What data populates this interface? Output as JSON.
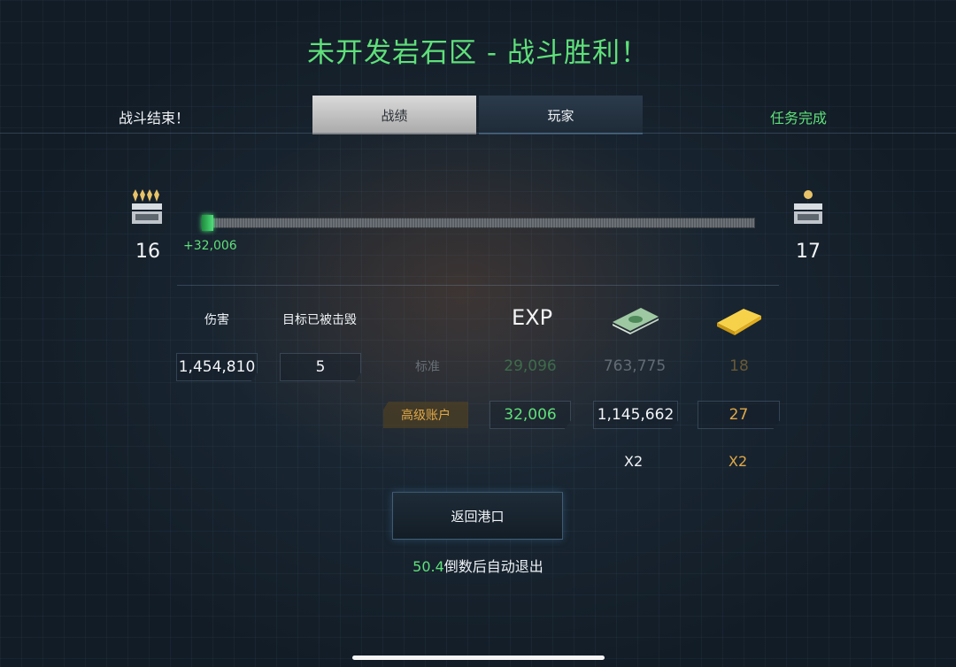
{
  "header": {
    "title": "未开发岩石区 - 战斗胜利！",
    "battle_over": "战斗结束！",
    "mission_complete": "任务完成",
    "tabs": [
      "战绩",
      "玩家"
    ]
  },
  "progress": {
    "level_current": "16",
    "level_next": "17",
    "xp_gain": "+32,006",
    "fill_fraction": 0.02
  },
  "stats": {
    "damage_label": "伤害",
    "damage_value": "1,454,810",
    "destroyed_label": "目标已被击毁",
    "destroyed_value": "5"
  },
  "rewards": {
    "exp_label": "EXP",
    "standard_label": "标准",
    "standard": {
      "exp": "29,096",
      "credits": "763,775",
      "gold": "18"
    },
    "premium_label": "高级账户",
    "premium": {
      "exp": "32,006",
      "credits": "1,145,662",
      "gold": "27"
    },
    "credits_multiplier": "X2",
    "gold_multiplier": "X2"
  },
  "footer": {
    "return_button": "返回港口",
    "countdown_value": "50.4",
    "countdown_text": "倒数后自动退出"
  },
  "colors": {
    "accent_green": "#5fe07a",
    "gold": "#e0a948"
  },
  "icons": {
    "rank_left": "rank-insignia-icon",
    "rank_right": "rank-insignia-icon",
    "credits": "money-stack-icon",
    "gold": "gold-bar-icon"
  }
}
